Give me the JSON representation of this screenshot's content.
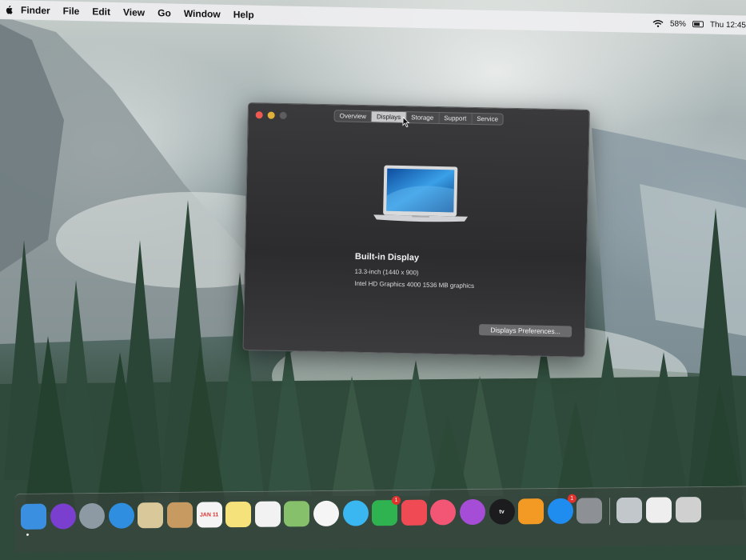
{
  "menubar": {
    "app_name": "Finder",
    "items": [
      "File",
      "Edit",
      "View",
      "Go",
      "Window",
      "Help"
    ],
    "battery_percent": "58%",
    "clock": "Thu 12:45"
  },
  "window": {
    "tabs": [
      {
        "label": "Overview",
        "active": false
      },
      {
        "label": "Displays",
        "active": true
      },
      {
        "label": "Storage",
        "active": false
      },
      {
        "label": "Support",
        "active": false
      },
      {
        "label": "Service",
        "active": false
      }
    ],
    "display_name": "Built-in Display",
    "display_size": "13.3-inch (1440 x 900)",
    "graphics": "Intel HD Graphics 4000 1536 MB graphics",
    "prefs_button": "Displays Preferences..."
  },
  "dock": {
    "apps": [
      {
        "name": "finder-icon",
        "color": "#3a8fe0"
      },
      {
        "name": "siri-icon",
        "color": "#7b3fd0",
        "round": true
      },
      {
        "name": "launchpad-icon",
        "color": "#8e9aa3",
        "round": true
      },
      {
        "name": "safari-icon",
        "color": "#2f8ee0",
        "round": true
      },
      {
        "name": "mail-stamp-icon",
        "color": "#d8c89a"
      },
      {
        "name": "contacts-icon",
        "color": "#c79a62"
      },
      {
        "name": "calendar-icon",
        "color": "#f4f4f4",
        "text": "JAN 11"
      },
      {
        "name": "notes-icon",
        "color": "#f6e27a"
      },
      {
        "name": "reminders-icon",
        "color": "#f2f2f2"
      },
      {
        "name": "maps-icon",
        "color": "#86c06a"
      },
      {
        "name": "photos-icon",
        "color": "#f5f5f5",
        "round": true
      },
      {
        "name": "messages-icon",
        "color": "#3ab7f0",
        "round": true
      },
      {
        "name": "facetime-icon",
        "color": "#2fb351",
        "badge": "1"
      },
      {
        "name": "news-icon",
        "color": "#f04b55"
      },
      {
        "name": "music-icon",
        "color": "#f35675",
        "round": true
      },
      {
        "name": "podcasts-icon",
        "color": "#a54dd6",
        "round": true
      },
      {
        "name": "apple-tv-icon",
        "color": "#1c1c1e",
        "round": true,
        "text": "tv"
      },
      {
        "name": "books-icon",
        "color": "#f39a24"
      },
      {
        "name": "app-store-icon",
        "color": "#1f8df0",
        "round": true,
        "badge": "1"
      },
      {
        "name": "system-preferences-icon",
        "color": "#8d9196"
      },
      {
        "name": "preview-icon",
        "color": "#c2c7cc"
      },
      {
        "name": "textedit-icon",
        "color": "#eeeeee"
      },
      {
        "name": "utility-icon",
        "color": "#d0d0d0"
      }
    ]
  }
}
